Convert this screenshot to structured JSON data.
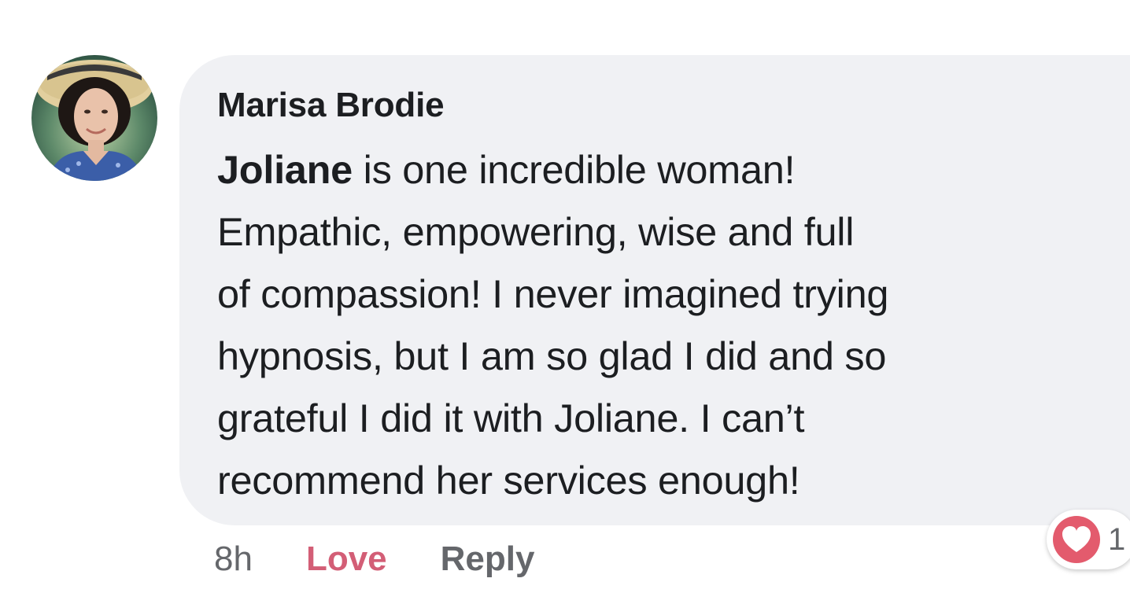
{
  "comment": {
    "author": "Marisa Brodie",
    "mention": "Joliane",
    "text_lines": [
      " is one incredible woman!",
      "Empathic, empowering, wise and full",
      "of compassion! I never imagined trying",
      "hypnosis, but I am so glad I did and so",
      "grateful I did it with Joliane. I can’t",
      "recommend her services enough!"
    ]
  },
  "actions": {
    "time": "8h",
    "love_label": "Love",
    "reply_label": "Reply"
  },
  "reactions": {
    "icon": "love-heart-icon",
    "count": "1"
  },
  "colors": {
    "bubble": "#f0f1f4",
    "love": "#d35e76",
    "meta": "#65676b",
    "text": "#1c1e21"
  }
}
